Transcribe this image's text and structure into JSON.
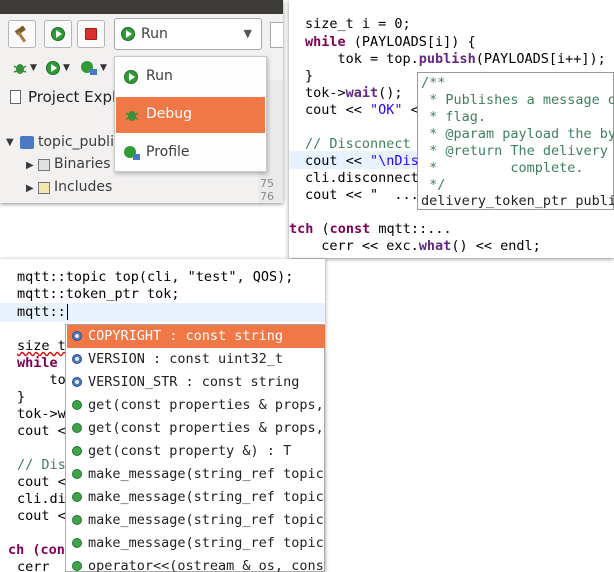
{
  "run_menu": {
    "combo_label": "Run",
    "items": [
      {
        "label": "Run",
        "selected": false
      },
      {
        "label": "Debug",
        "selected": true
      },
      {
        "label": "Profile",
        "selected": false
      }
    ],
    "accent": "#f07746"
  },
  "project_explorer": {
    "title": "Project Explo",
    "project": "topic_publi",
    "children": [
      "Binaries",
      "Includes"
    ],
    "line_numbers": [
      "75",
      "76"
    ]
  },
  "code_panel": {
    "lines": [
      [
        "size_t i = 0;"
      ],
      [
        "while",
        " (PAYLOADS[i]) {"
      ],
      [
        "    tok = top.",
        "publish",
        "(PAYLOADS[i++]);"
      ],
      [
        "}"
      ],
      [
        "tok->",
        "wait",
        "();"
      ],
      [
        "cout << ",
        "\"OK\"",
        " <"
      ],
      [
        ""
      ],
      [
        "// Disconnect"
      ],
      [
        "cout << ",
        "\"\\nDis"
      ],
      [
        "cli.disconnect"
      ],
      [
        "cout << \"  ..."
      ],
      [
        ""
      ],
      [
        "tch",
        " (",
        "const",
        " mqtt::",
        "..."
      ],
      [
        "  cerr << exc.",
        "what",
        "() << endl;"
      ]
    ],
    "tooltip": {
      "comment": [
        "/**",
        " * Publishes a message o",
        " * flag.",
        " * @param payload the by",
        " * @return The delivery",
        " *         complete.",
        " */"
      ],
      "signature": "delivery_token_ptr publi"
    }
  },
  "autocomplete_panel": {
    "code": [
      "mqtt::topic top(cli, \"test\", QOS);",
      "mqtt::token_ptr tok;",
      "mqtt::"
    ],
    "background_lines": [
      "size t",
      "while",
      "    to",
      "}",
      "tok->w",
      "cout <",
      "",
      "// Dis",
      "cout <",
      "cli.di",
      "cout <",
      "",
      "ch (con",
      "cerr"
    ],
    "items": [
      {
        "label": "COPYRIGHT : const string",
        "icon": "static-field-icon",
        "selected": true
      },
      {
        "label": "VERSION : const uint32_t",
        "icon": "static-field-icon",
        "selected": false
      },
      {
        "label": "VERSION_STR : const string",
        "icon": "static-field-icon",
        "selected": false
      },
      {
        "label": "get(const properties & props, enum",
        "icon": "function-icon",
        "selected": false
      },
      {
        "label": "get(const properties & props, enum",
        "icon": "function-icon",
        "selected": false
      },
      {
        "label": "get(const property &) : T",
        "icon": "function-icon",
        "selected": false
      },
      {
        "label": "make_message(string_ref topic, bin",
        "icon": "function-icon",
        "selected": false
      },
      {
        "label": "make_message(string_ref topic, bin",
        "icon": "function-icon",
        "selected": false
      },
      {
        "label": "make_message(string_ref topic, con",
        "icon": "function-icon",
        "selected": false
      },
      {
        "label": "make_message(string_ref topic, con",
        "icon": "function-icon",
        "selected": false
      },
      {
        "label": "operator<<(ostream & os, const buf",
        "icon": "function-icon",
        "selected": false
      }
    ]
  }
}
